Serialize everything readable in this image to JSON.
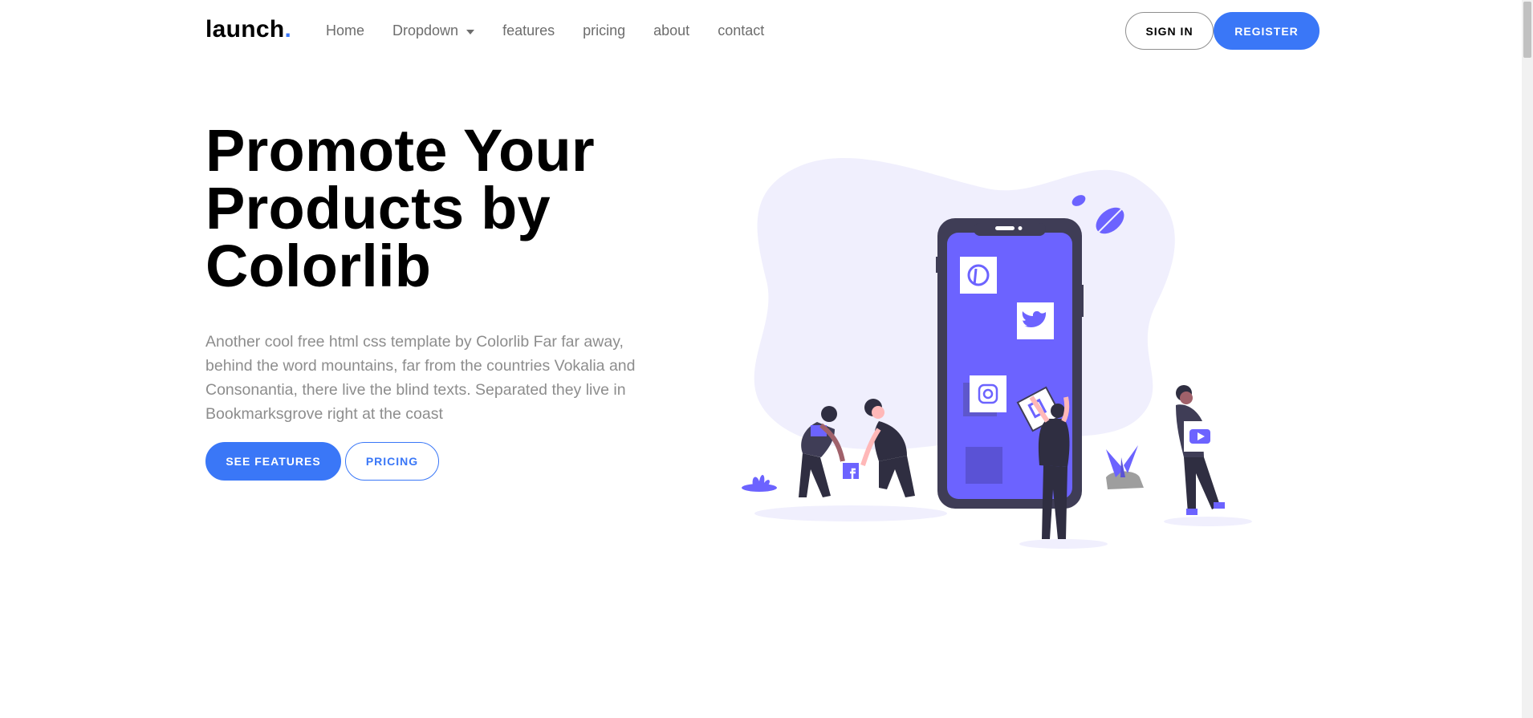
{
  "nav": {
    "brand": "launch",
    "brand_dot": ".",
    "links": [
      "Home",
      "Dropdown",
      "features",
      "pricing",
      "about",
      "contact"
    ],
    "signin_label": "SIGN IN",
    "register_label": "REGISTER"
  },
  "hero": {
    "title_line1": "Promote Your",
    "title_line2": "Products by",
    "title_line3": "Colorlib",
    "text": "Another cool free html css template by Colorlib Far far away, behind the word mountains, far from the countries Vokalia and Consonantia, there live the blind texts. Separated they live in Bookmarksgrove right at the coast",
    "features_label": "SEE FEATURES",
    "pricing_label": "PRICING"
  },
  "icons": {
    "dropdown": "caret-down-icon",
    "illustration": "social-media-phone-illustration"
  },
  "colors": {
    "accent": "#3a77f7",
    "illustration_primary": "#6c63ff",
    "illustration_blob": "#f0effd",
    "illustration_dark": "#3f3d56",
    "text_muted": "#8d8d8d"
  }
}
